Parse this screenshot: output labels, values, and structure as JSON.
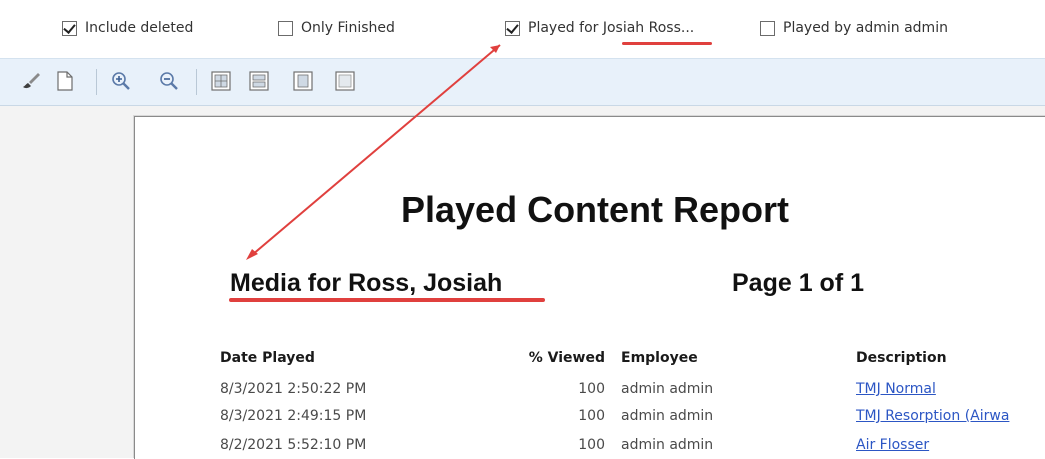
{
  "filters": {
    "include_deleted": {
      "label": "Include deleted",
      "checked": true
    },
    "only_finished": {
      "label": "Only Finished",
      "checked": false
    },
    "played_for": {
      "label": "Played for Josiah Ross...",
      "checked": true
    },
    "played_by": {
      "label": "Played by admin admin",
      "checked": false
    }
  },
  "toolbar": {
    "buttons": [
      "paint-brush-icon",
      "page-icon",
      "zoom-in-icon",
      "zoom-out-icon",
      "one-page-icon",
      "two-page-icon",
      "page-width-icon",
      "whole-page-icon"
    ]
  },
  "report": {
    "title": "Played Content Report",
    "subtitle": "Media for Ross, Josiah",
    "page_label": "Page 1 of 1",
    "columns": {
      "date": "Date Played",
      "viewed": "% Viewed",
      "employee": "Employee",
      "description": "Description"
    },
    "rows": [
      {
        "date": "8/3/2021 2:50:22 PM",
        "viewed": "100",
        "employee": "admin admin",
        "description": "TMJ Normal"
      },
      {
        "date": "8/3/2021 2:49:15 PM",
        "viewed": "100",
        "employee": "admin admin",
        "description": "TMJ Resorption (Airwa"
      },
      {
        "date": "8/2/2021 5:52:10 PM",
        "viewed": "100",
        "employee": "admin admin",
        "description": "Air Flosser"
      }
    ]
  },
  "colors": {
    "annotation": "#e0403e",
    "toolbar_bg": "#e8f1fa",
    "link": "#2c56c4"
  }
}
